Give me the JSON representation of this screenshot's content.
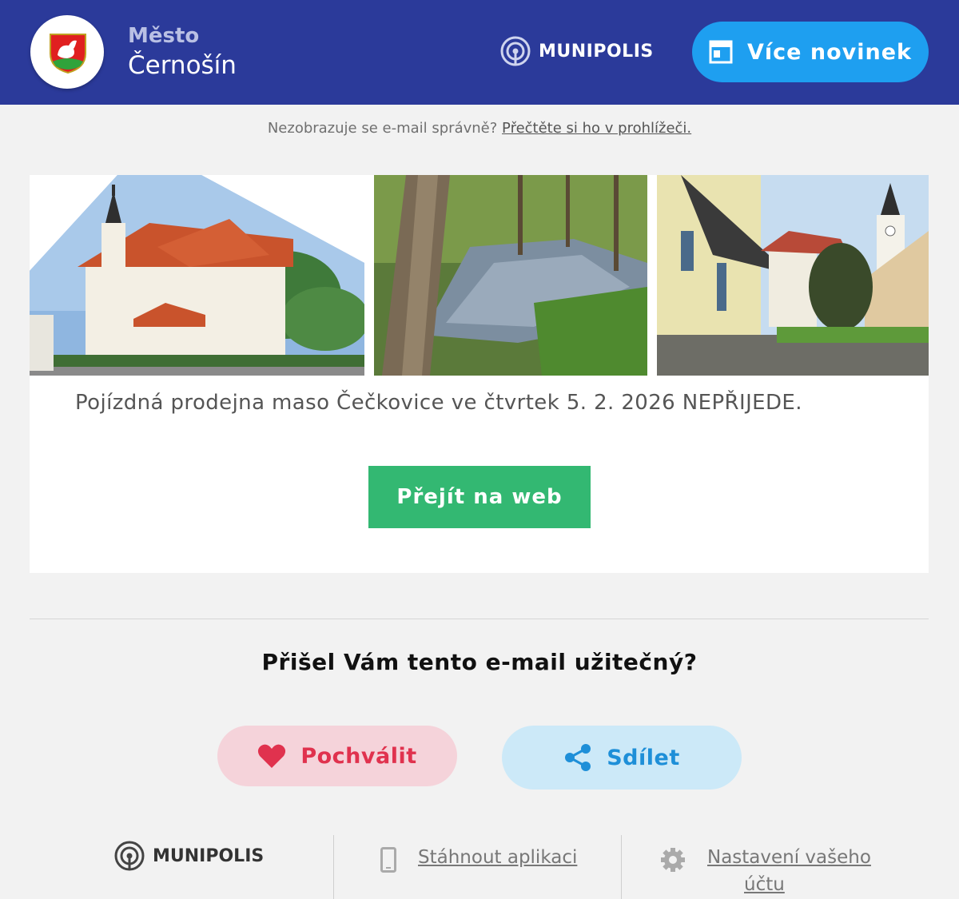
{
  "header": {
    "town_prefix": "Město",
    "town_name": "Černošín",
    "brand": "MUNIPOLIS",
    "more_news_label": "Více novinek",
    "bg_color": "#2b3a9a",
    "accent_color": "#1e9ff0"
  },
  "notice": {
    "text": "Nezobrazuje se e-mail správně?",
    "link_label": "Přečtěte si ho v prohlížeči."
  },
  "article": {
    "photos": [
      "church-photo",
      "river-photo",
      "village-street-photo"
    ],
    "text": "Pojízdná prodejna maso Čečkovice ve čtvrtek 5. 2. 2026 NEPŘIJEDE.",
    "button_label": "Přejít na web",
    "button_color": "#33b872"
  },
  "feedback": {
    "question": "Přišel Vám tento e-mail užitečný?",
    "praise_label": "Pochválit",
    "share_label": "Sdílet"
  },
  "footer": {
    "brand": "MUNIPOLIS",
    "download_label": "Stáhnout aplikaci",
    "settings_label_1": "Nastavení vašeho",
    "settings_label_2": "účtu"
  }
}
